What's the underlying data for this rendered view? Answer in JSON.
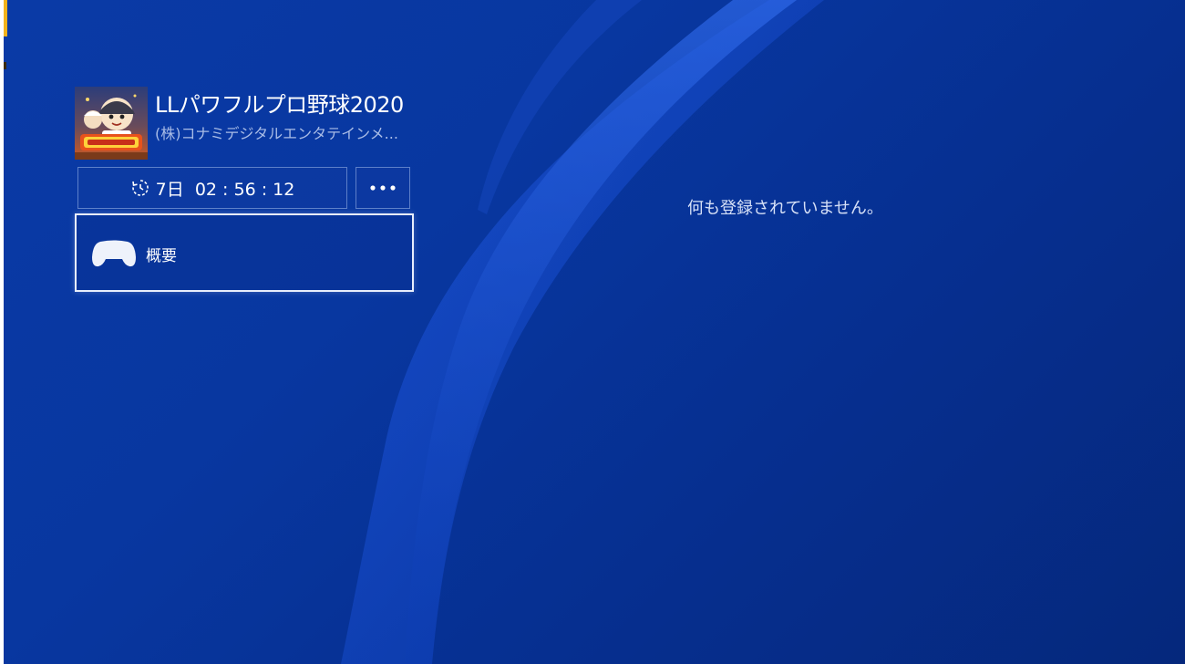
{
  "game": {
    "title": "LLパワフルプロ野球2020",
    "publisher": "(株)コナミデジタルエンタテインメ...",
    "thumbnail_icon": "game-cover-art"
  },
  "controls": {
    "timer_label": "7日  02 : 56 : 12",
    "timer_icon": "stopwatch-icon",
    "more_icon": "ellipsis-icon"
  },
  "menu": {
    "items": [
      {
        "label": "概要",
        "icon": "controller-icon",
        "selected": true
      }
    ]
  },
  "content": {
    "empty_message": "何も登録されていません。"
  },
  "colors": {
    "background": "#0837a0",
    "accent_tab": "#f2b21c",
    "publisher_text": "#a9bce6"
  }
}
